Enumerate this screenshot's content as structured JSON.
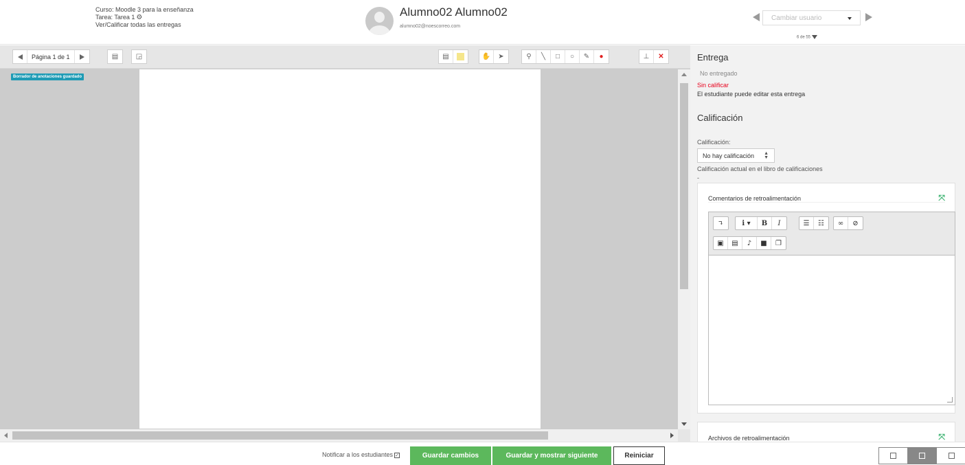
{
  "header": {
    "course_line": "Curso: Moodle 3 para la enseñanza",
    "task_line": "Tarea: Tarea 1",
    "view_all_link": "Ver/Calificar todas las entregas",
    "user_name": "Alumno02 Alumno02",
    "user_email": "alumno02@noescorreo.com",
    "user_select_placeholder": "Cambiar usuario",
    "user_count": "6 de 55"
  },
  "viewer": {
    "page_label": "Página 1 de 1",
    "saved_badge": "Borrador de anotaciones guardado",
    "colors": {
      "comment": "#f5e68c",
      "annotation_red": "#e02020",
      "badge": "#1e9bb5"
    }
  },
  "panel": {
    "submission_heading": "Entrega",
    "submission_status": "No entregado",
    "grading_status": "Sin calificar",
    "edit_status": "El estudiante puede editar esta entrega",
    "grade_heading": "Calificación",
    "grade_label": "Calificación:",
    "grade_select_value": "No hay calificación",
    "gradebook_label": "Calificación actual en el libro de calificaciones",
    "gradebook_value": "-",
    "feedback_comments_title": "Comentarios de retroalimentación",
    "feedback_files_title": "Archivos de retroalimentación",
    "colors": {
      "grading_status": "#e8001c",
      "expand": "#3cb371"
    }
  },
  "footer": {
    "notify_label": "Notificar a los estudiantes",
    "save_button": "Guardar cambios",
    "save_next_button": "Guardar y mostrar siguiente",
    "reset_button": "Reiniciar",
    "colors": {
      "primary_button": "#5cb85c"
    }
  }
}
